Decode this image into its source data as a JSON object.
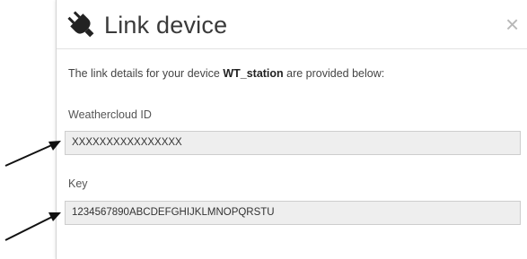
{
  "dialog": {
    "title": "Link device",
    "close_label": "×",
    "intro_prefix": "The link details for your device ",
    "device_name": "WT_station",
    "intro_suffix": " are provided below:"
  },
  "fields": {
    "weathercloud_id": {
      "label": "Weathercloud ID",
      "value": "XXXXXXXXXXXXXXXX"
    },
    "key": {
      "label": "Key",
      "value": "1234567890ABCDEFGHIJKLMNOPQRSTU"
    }
  },
  "icons": {
    "title_icon": "plug-icon",
    "close_icon": "close-icon",
    "annotation": "arrow-icon"
  }
}
